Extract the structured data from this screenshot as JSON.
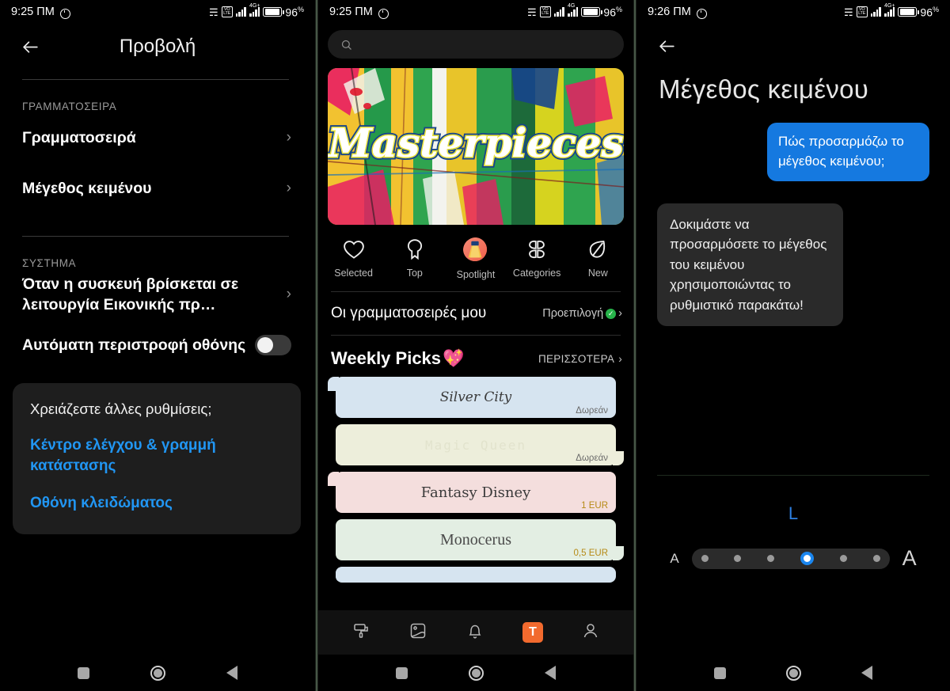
{
  "panel1": {
    "status": {
      "time": "9:25 ΠΜ",
      "battery": "96",
      "battery_unit": "%",
      "network": "4G+",
      "volte": "VoLTE"
    },
    "title": "Προβολή",
    "sections": [
      {
        "label": "ΓΡΑΜΜΑΤΟΣΕΙΡΑ",
        "rows": [
          {
            "label": "Γραμματοσειρά",
            "type": "chevron"
          },
          {
            "label": "Μέγεθος κειμένου",
            "type": "chevron"
          }
        ]
      },
      {
        "label": "ΣΥΣΤΗΜΑ",
        "rows": [
          {
            "label": "Όταν η συσκευή βρίσκεται σε λειτουργία Εικονικής πρ…",
            "type": "chevron"
          },
          {
            "label": "Αυτόματη περιστροφή οθόνης",
            "type": "toggle",
            "value": "off"
          }
        ]
      }
    ],
    "help": {
      "question": "Χρειάζεστε άλλες ρυθμίσεις;",
      "links": [
        "Κέντρο ελέγχου & γραμμή κατάστασης",
        "Οθόνη κλειδώματος"
      ]
    },
    "chevron_glyph": "›"
  },
  "panel2": {
    "status": {
      "time": "9:25 ΠΜ",
      "battery": "96",
      "battery_unit": "%",
      "network": "4G",
      "volte": "VoLTE"
    },
    "search": {
      "placeholder": "",
      "value": ""
    },
    "banner": {
      "text": "Masterpieces"
    },
    "categories": [
      {
        "label": "Selected",
        "icon": "heart-icon"
      },
      {
        "label": "Top",
        "icon": "bookmark-icon"
      },
      {
        "label": "Spotlight",
        "icon": "spotlight-icon"
      },
      {
        "label": "Categories",
        "icon": "grid-clover-icon"
      },
      {
        "label": "New",
        "icon": "leaf-icon"
      }
    ],
    "my_fonts": {
      "title": "Οι γραμματοσειρές μου",
      "value": "Προεπιλογή",
      "badge": "✓",
      "chevron": "›"
    },
    "weekly": {
      "title": "Weekly Picks",
      "emoji": "💖",
      "more": "ΠΕΡΙΣΣΟΤΕΡΑ",
      "more_chevron": "›",
      "cards": [
        {
          "name": "Silver City",
          "price": "Δωρεάν",
          "paid": false,
          "color": "#d6e4f0",
          "font": "cursive"
        },
        {
          "name": "Magic  Queen",
          "price": "Δωρεάν",
          "paid": false,
          "color": "#edeedb",
          "font": "mono"
        },
        {
          "name": "Fantasy Disney",
          "price": "1 EUR",
          "paid": true,
          "color": "#f4dedd",
          "font": "fancy"
        },
        {
          "name": "Monocerus",
          "price": "0,5 EUR",
          "paid": true,
          "color": "#e3eee3",
          "font": "serif"
        },
        {
          "name": "",
          "price": "",
          "paid": false,
          "color": "#d6e4f0",
          "font": "cursive"
        }
      ]
    },
    "bottom_nav": [
      {
        "icon": "paint-roller-icon",
        "active": false
      },
      {
        "icon": "image-icon",
        "active": false
      },
      {
        "icon": "bell-icon",
        "active": false
      },
      {
        "icon": "text-t-icon",
        "active": true,
        "label": "T"
      },
      {
        "icon": "person-icon",
        "active": false
      }
    ]
  },
  "panel3": {
    "status": {
      "time": "9:26 ΠΜ",
      "battery": "96",
      "battery_unit": "%",
      "network": "4G+",
      "volte": "VoLTE"
    },
    "title": "Μέγεθος κειμένου",
    "chat": [
      {
        "from": "outgoing",
        "text": "Πώς προσαρμόζω το μέγεθος κειμένου;"
      },
      {
        "from": "incoming",
        "text": "Δοκιμάστε να προσαρμόσετε το μέγεθος του κειμένου χρησιμοποιώντας το ρυθμιστικό παρακάτω!"
      }
    ],
    "slider": {
      "current_label": "L",
      "min_label": "A",
      "max_label": "A",
      "steps": 6,
      "selected_index": 3
    }
  },
  "android_nav": {
    "recents": "recents-square",
    "home": "home-circle",
    "back": "back-triangle"
  },
  "colors": {
    "accent_blue": "#1579e0",
    "link_blue": "#2196f3",
    "slider_blue": "#1a86ef",
    "badge_green": "#27b34a",
    "orange": "#f26a2e",
    "price_gold": "#b68a15"
  }
}
